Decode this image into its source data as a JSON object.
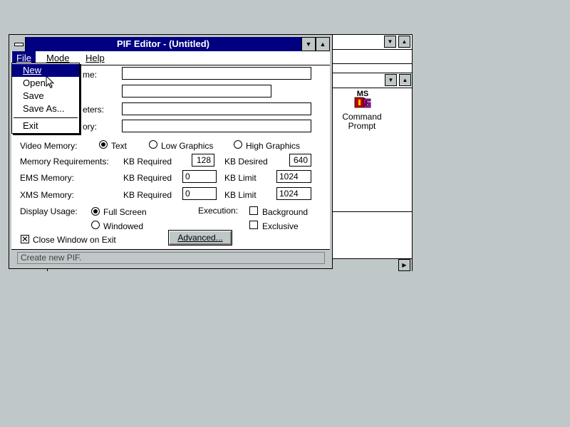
{
  "window": {
    "title": "PIF Editor - (Untitled)",
    "minimize_glyph": "▼",
    "maximize_glyph": "▲"
  },
  "menubar": {
    "file": "File",
    "mode": "Mode",
    "help": "Help"
  },
  "file_menu": {
    "new": "New",
    "open": "Open...",
    "save": "Save",
    "save_as": "Save As...",
    "exit": "Exit"
  },
  "form": {
    "program_filename_partial": "me:",
    "parameters_partial": "eters:",
    "startup_directory_partial": "ory:",
    "video_memory": {
      "label": "Video Memory:",
      "options": [
        "Text",
        "Low Graphics",
        "High Graphics"
      ],
      "selected": "Text"
    },
    "memory_requirements": {
      "label": "Memory Requirements:",
      "kb_required_label": "KB Required",
      "kb_required": "128",
      "kb_desired_label": "KB Desired",
      "kb_desired": "640"
    },
    "ems_memory": {
      "label": "EMS Memory:",
      "kb_required_label": "KB Required",
      "kb_required": "0",
      "kb_limit_label": "KB Limit",
      "kb_limit": "1024"
    },
    "xms_memory": {
      "label": "XMS Memory:",
      "kb_required_label": "KB Required",
      "kb_required": "0",
      "kb_limit_label": "KB Limit",
      "kb_limit": "1024"
    },
    "display_usage": {
      "label": "Display Usage:",
      "options": [
        "Full Screen",
        "Windowed"
      ],
      "selected": "Full Screen"
    },
    "execution": {
      "label": "Execution:",
      "background": "Background",
      "exclusive": "Exclusive",
      "background_checked": false,
      "exclusive_checked": false
    },
    "close_window_on_exit": {
      "label": "Close Window on Exit",
      "checked": true
    },
    "advanced_button": "Advanced..."
  },
  "status": {
    "text": "Create new PIF."
  },
  "background_window": {
    "icon_label_line1": "Command",
    "icon_label_line2": "Prompt",
    "icon_logo_text": "MS"
  },
  "colors": {
    "desktop": "#c0c7c8",
    "title_active": "#000080",
    "menu_highlight": "#000080"
  }
}
